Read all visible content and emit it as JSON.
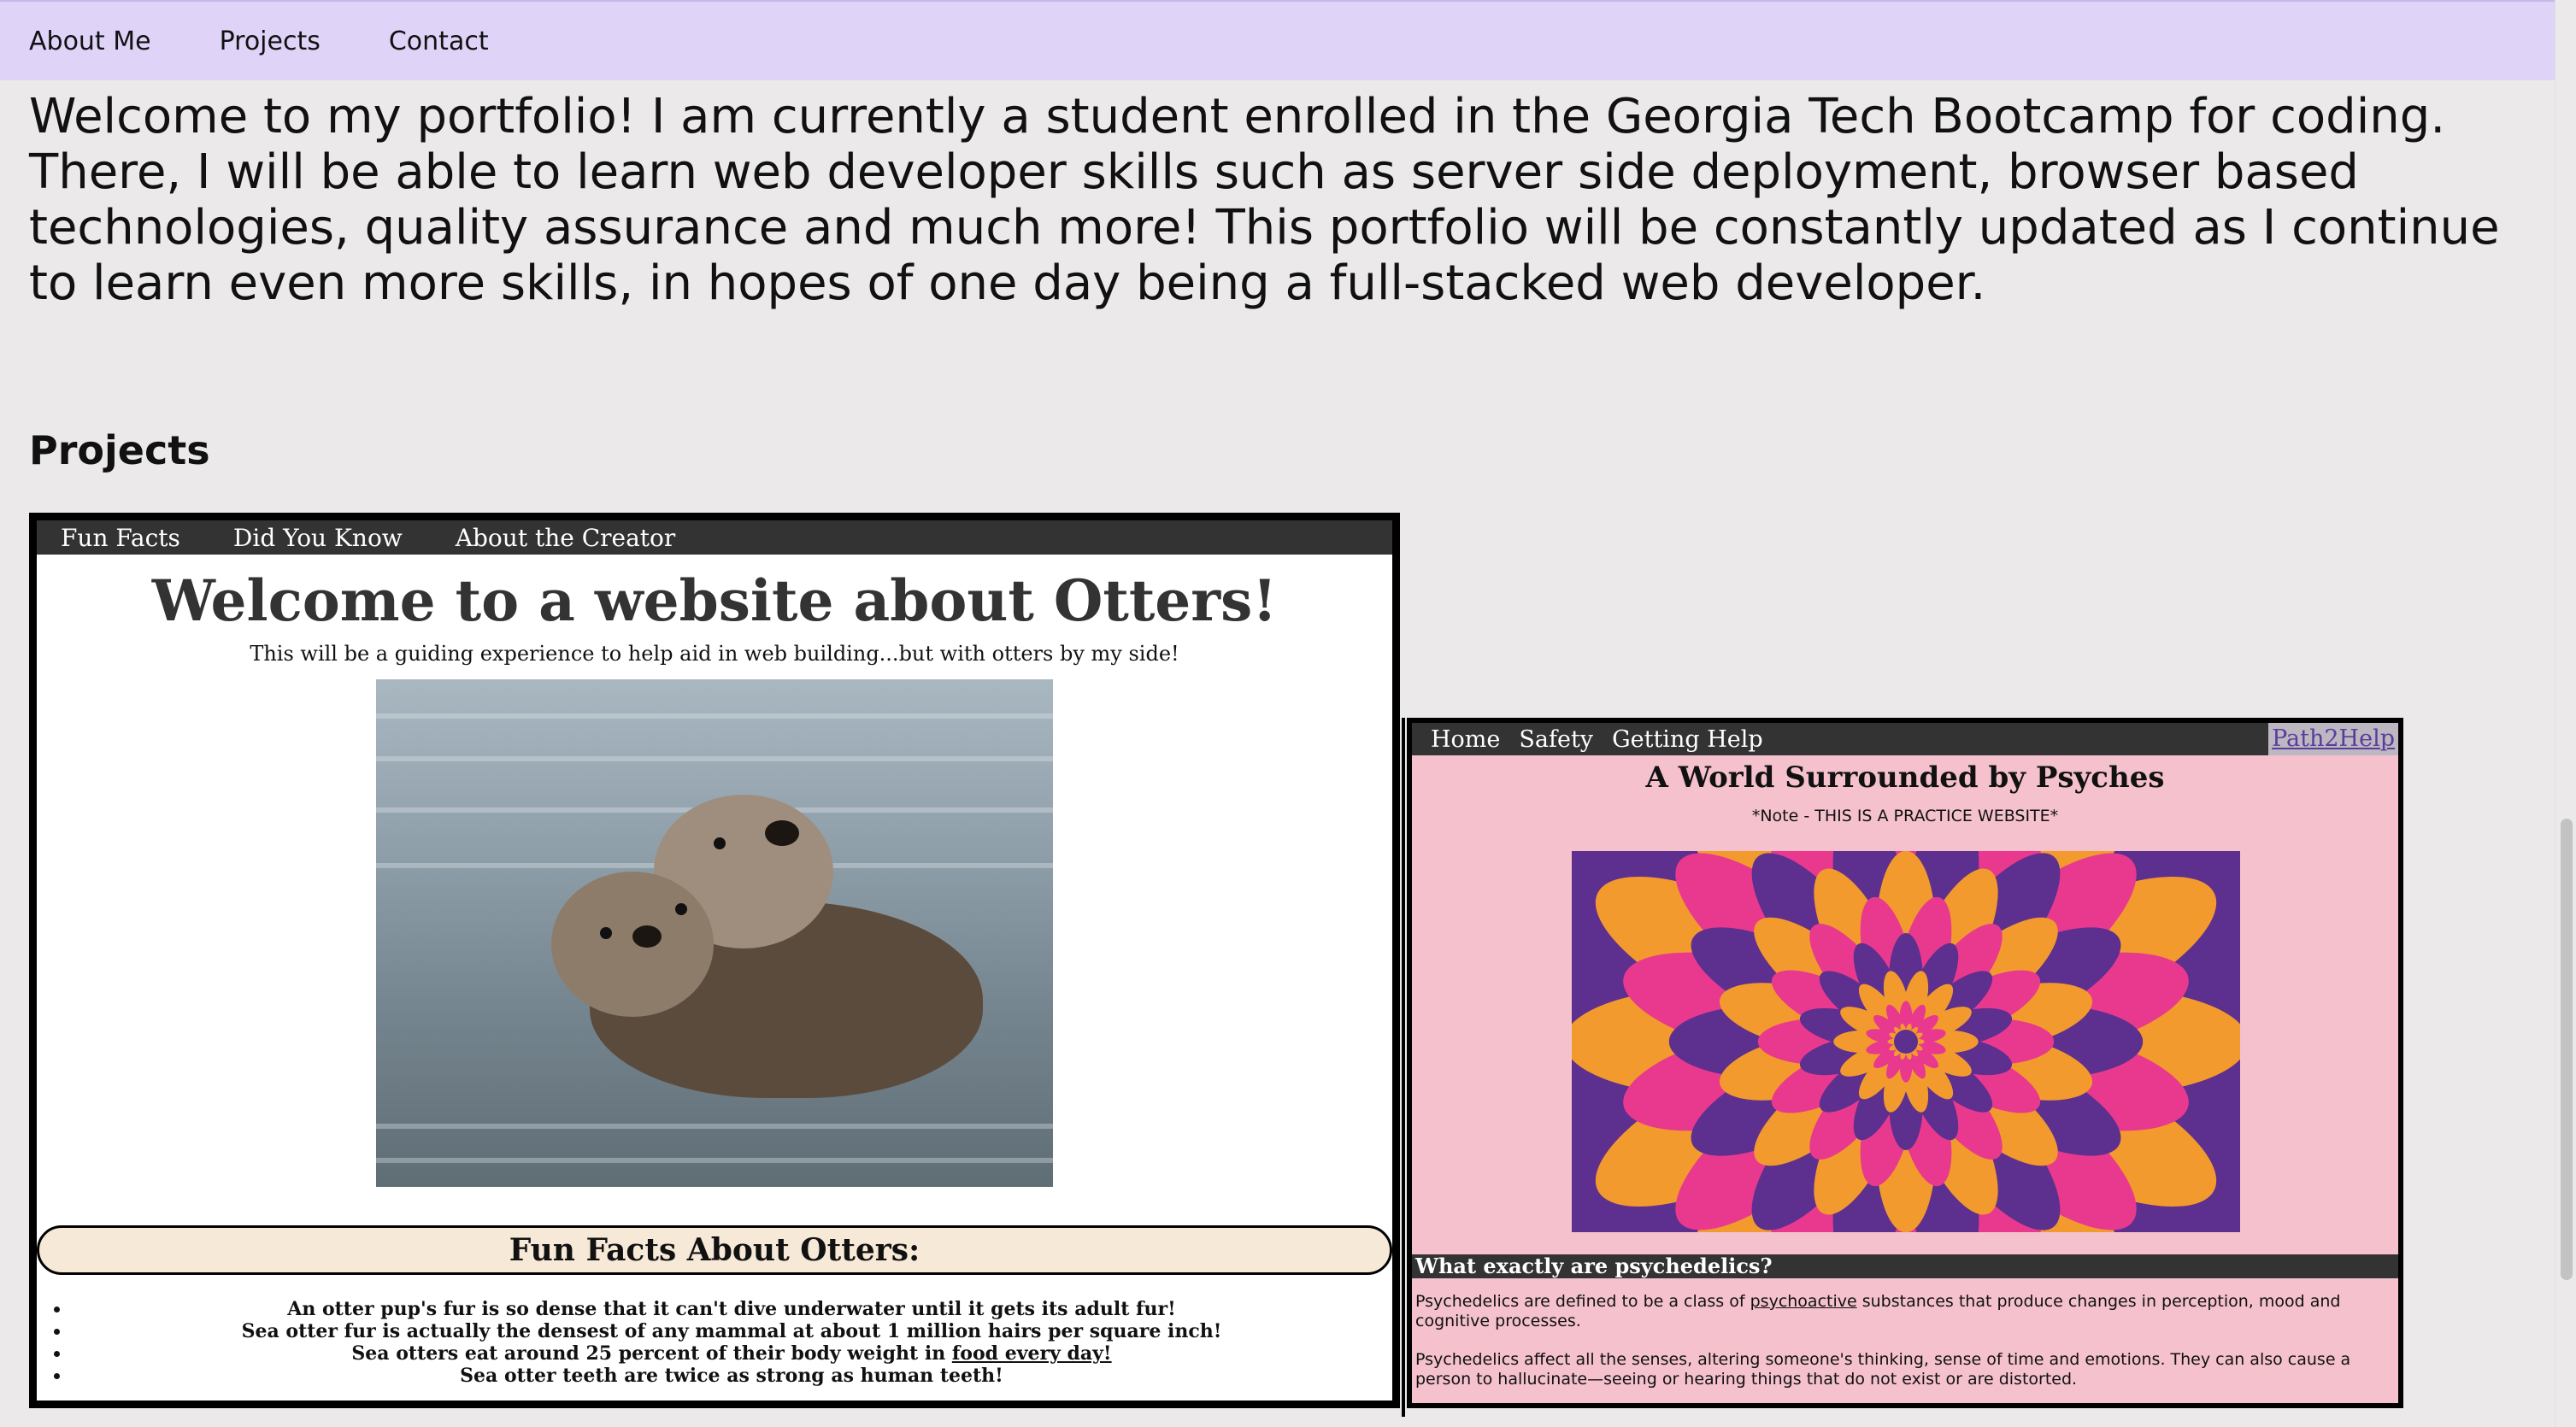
{
  "nav": {
    "items": [
      "About Me",
      "Projects",
      "Contact"
    ]
  },
  "intro": "Welcome to my portfolio! I am currently a student enrolled in the Georgia Tech Bootcamp for coding. There, I will be able to learn web developer skills such as server side deployment, browser based technologies, quality assurance and much more! This portfolio will be constantly updated as I continue to learn even more skills, in hopes of one day being a full-stacked web developer.",
  "projects_heading": "Projects",
  "otter": {
    "nav": [
      "Fun Facts",
      "Did You Know",
      "About the Creator"
    ],
    "title": "Welcome to a website about Otters!",
    "subtitle": "This will be a guiding experience to help aid in web building...but with otters by my side!",
    "facts_heading": "Fun Facts About Otters:",
    "facts": [
      "An otter pup's fur is so dense that it can't dive underwater until it gets its adult fur!",
      "Sea otter fur is actually the densest of any mammal at about 1 million hairs per square inch!",
      "Sea otters eat around 25 percent of their body weight in ",
      "Sea otter teeth are twice as strong as human teeth!"
    ],
    "fact_link": "food every day!"
  },
  "psyches": {
    "nav": [
      "Home",
      "Safety",
      "Getting Help"
    ],
    "brand": "Path2Help",
    "title": "A World Surrounded by Psyches",
    "note": "*Note - THIS IS A PRACTICE WEBSITE*",
    "question": "What exactly are psychedelics?",
    "p1_before": "Psychedelics are defined to be a class of ",
    "p1_link": "psychoactive",
    "p1_after": " substances that produce changes in perception, mood and cognitive processes.",
    "p2": "Psychedelics affect all the senses, altering someone's thinking, sense of time and emotions. They can also cause a person to hallucinate—seeing or hearing things that do not exist or are distorted."
  },
  "colors": {
    "nav_bg": "#e0d3f8",
    "page_bg": "#ebe9ea",
    "psy_bg": "#f4c1cd",
    "banner_bg": "#f7e9d8"
  }
}
